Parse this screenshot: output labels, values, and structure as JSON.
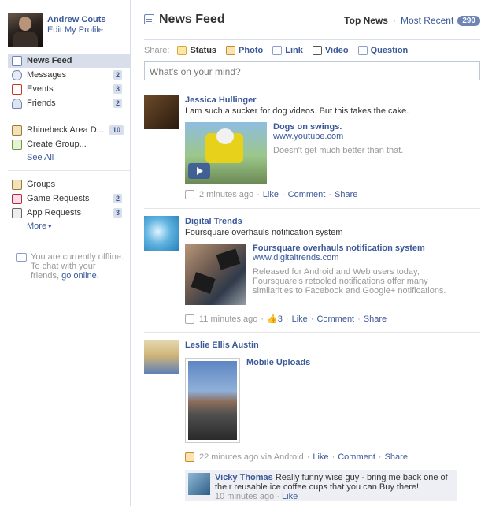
{
  "profile": {
    "name": "Andrew Couts",
    "edit_label": "Edit My Profile"
  },
  "sidebar": {
    "nav": [
      {
        "label": "News Feed",
        "count": "",
        "icon": "news-feed-icon"
      },
      {
        "label": "Messages",
        "count": "2",
        "icon": "messages-icon"
      },
      {
        "label": "Events",
        "count": "3",
        "icon": "events-icon"
      },
      {
        "label": "Friends",
        "count": "2",
        "icon": "friends-icon"
      }
    ],
    "groups_section": [
      {
        "label": "Rhinebeck Area D...",
        "count": "10",
        "icon": "network-icon"
      },
      {
        "label": "Create Group...",
        "count": "",
        "icon": "create-group-icon"
      }
    ],
    "see_all": "See All",
    "apps": [
      {
        "label": "Groups",
        "count": "",
        "icon": "groups-icon"
      },
      {
        "label": "Game Requests",
        "count": "2",
        "icon": "game-requests-icon"
      },
      {
        "label": "App Requests",
        "count": "3",
        "icon": "app-requests-icon"
      }
    ],
    "more": "More",
    "chat": {
      "text": "You are currently offline. To chat with your friends,",
      "link": "go online."
    }
  },
  "header": {
    "title": "News Feed",
    "top_news": "Top News",
    "dot": "·",
    "most_recent": "Most Recent",
    "badge": "290"
  },
  "share": {
    "label": "Share:",
    "items": [
      {
        "label": "Status",
        "icon": "status-icon"
      },
      {
        "label": "Photo",
        "icon": "photo-icon"
      },
      {
        "label": "Link",
        "icon": "link-icon"
      },
      {
        "label": "Video",
        "icon": "video-icon"
      },
      {
        "label": "Question",
        "icon": "question-icon"
      }
    ],
    "placeholder": "What's on your mind?"
  },
  "stories": [
    {
      "author": "Jessica Hullinger",
      "message": "I am such a sucker for dog videos. But this takes the cake.",
      "attachment": {
        "title": "Dogs on swings.",
        "url": "www.youtube.com",
        "desc": "Doesn't get much better than that."
      },
      "time": "2 minutes ago",
      "actions": [
        "Like",
        "Comment",
        "Share"
      ]
    },
    {
      "author": "Digital Trends",
      "message": "Foursquare overhauls notification system",
      "attachment": {
        "title": "Foursquare overhauls notification system",
        "url": "www.digitaltrends.com",
        "desc": "Released for Android and Web users today, Foursquare's retooled notifications offer many similarities to Facebook and Google+ notifications."
      },
      "time": "11 minutes ago",
      "likes": "3",
      "actions": [
        "Like",
        "Comment",
        "Share"
      ]
    },
    {
      "author": "Leslie Ellis Austin",
      "attachment": {
        "title": "Mobile Uploads"
      },
      "time": "22 minutes ago via Android",
      "actions": [
        "Like",
        "Comment",
        "Share"
      ],
      "comment": {
        "author": "Vicky Thomas",
        "text": "Really funny wise guy - bring me back one of their reusable ice coffee cups that you can Buy there!",
        "time": "10 minutes ago",
        "action": "Like"
      }
    }
  ]
}
